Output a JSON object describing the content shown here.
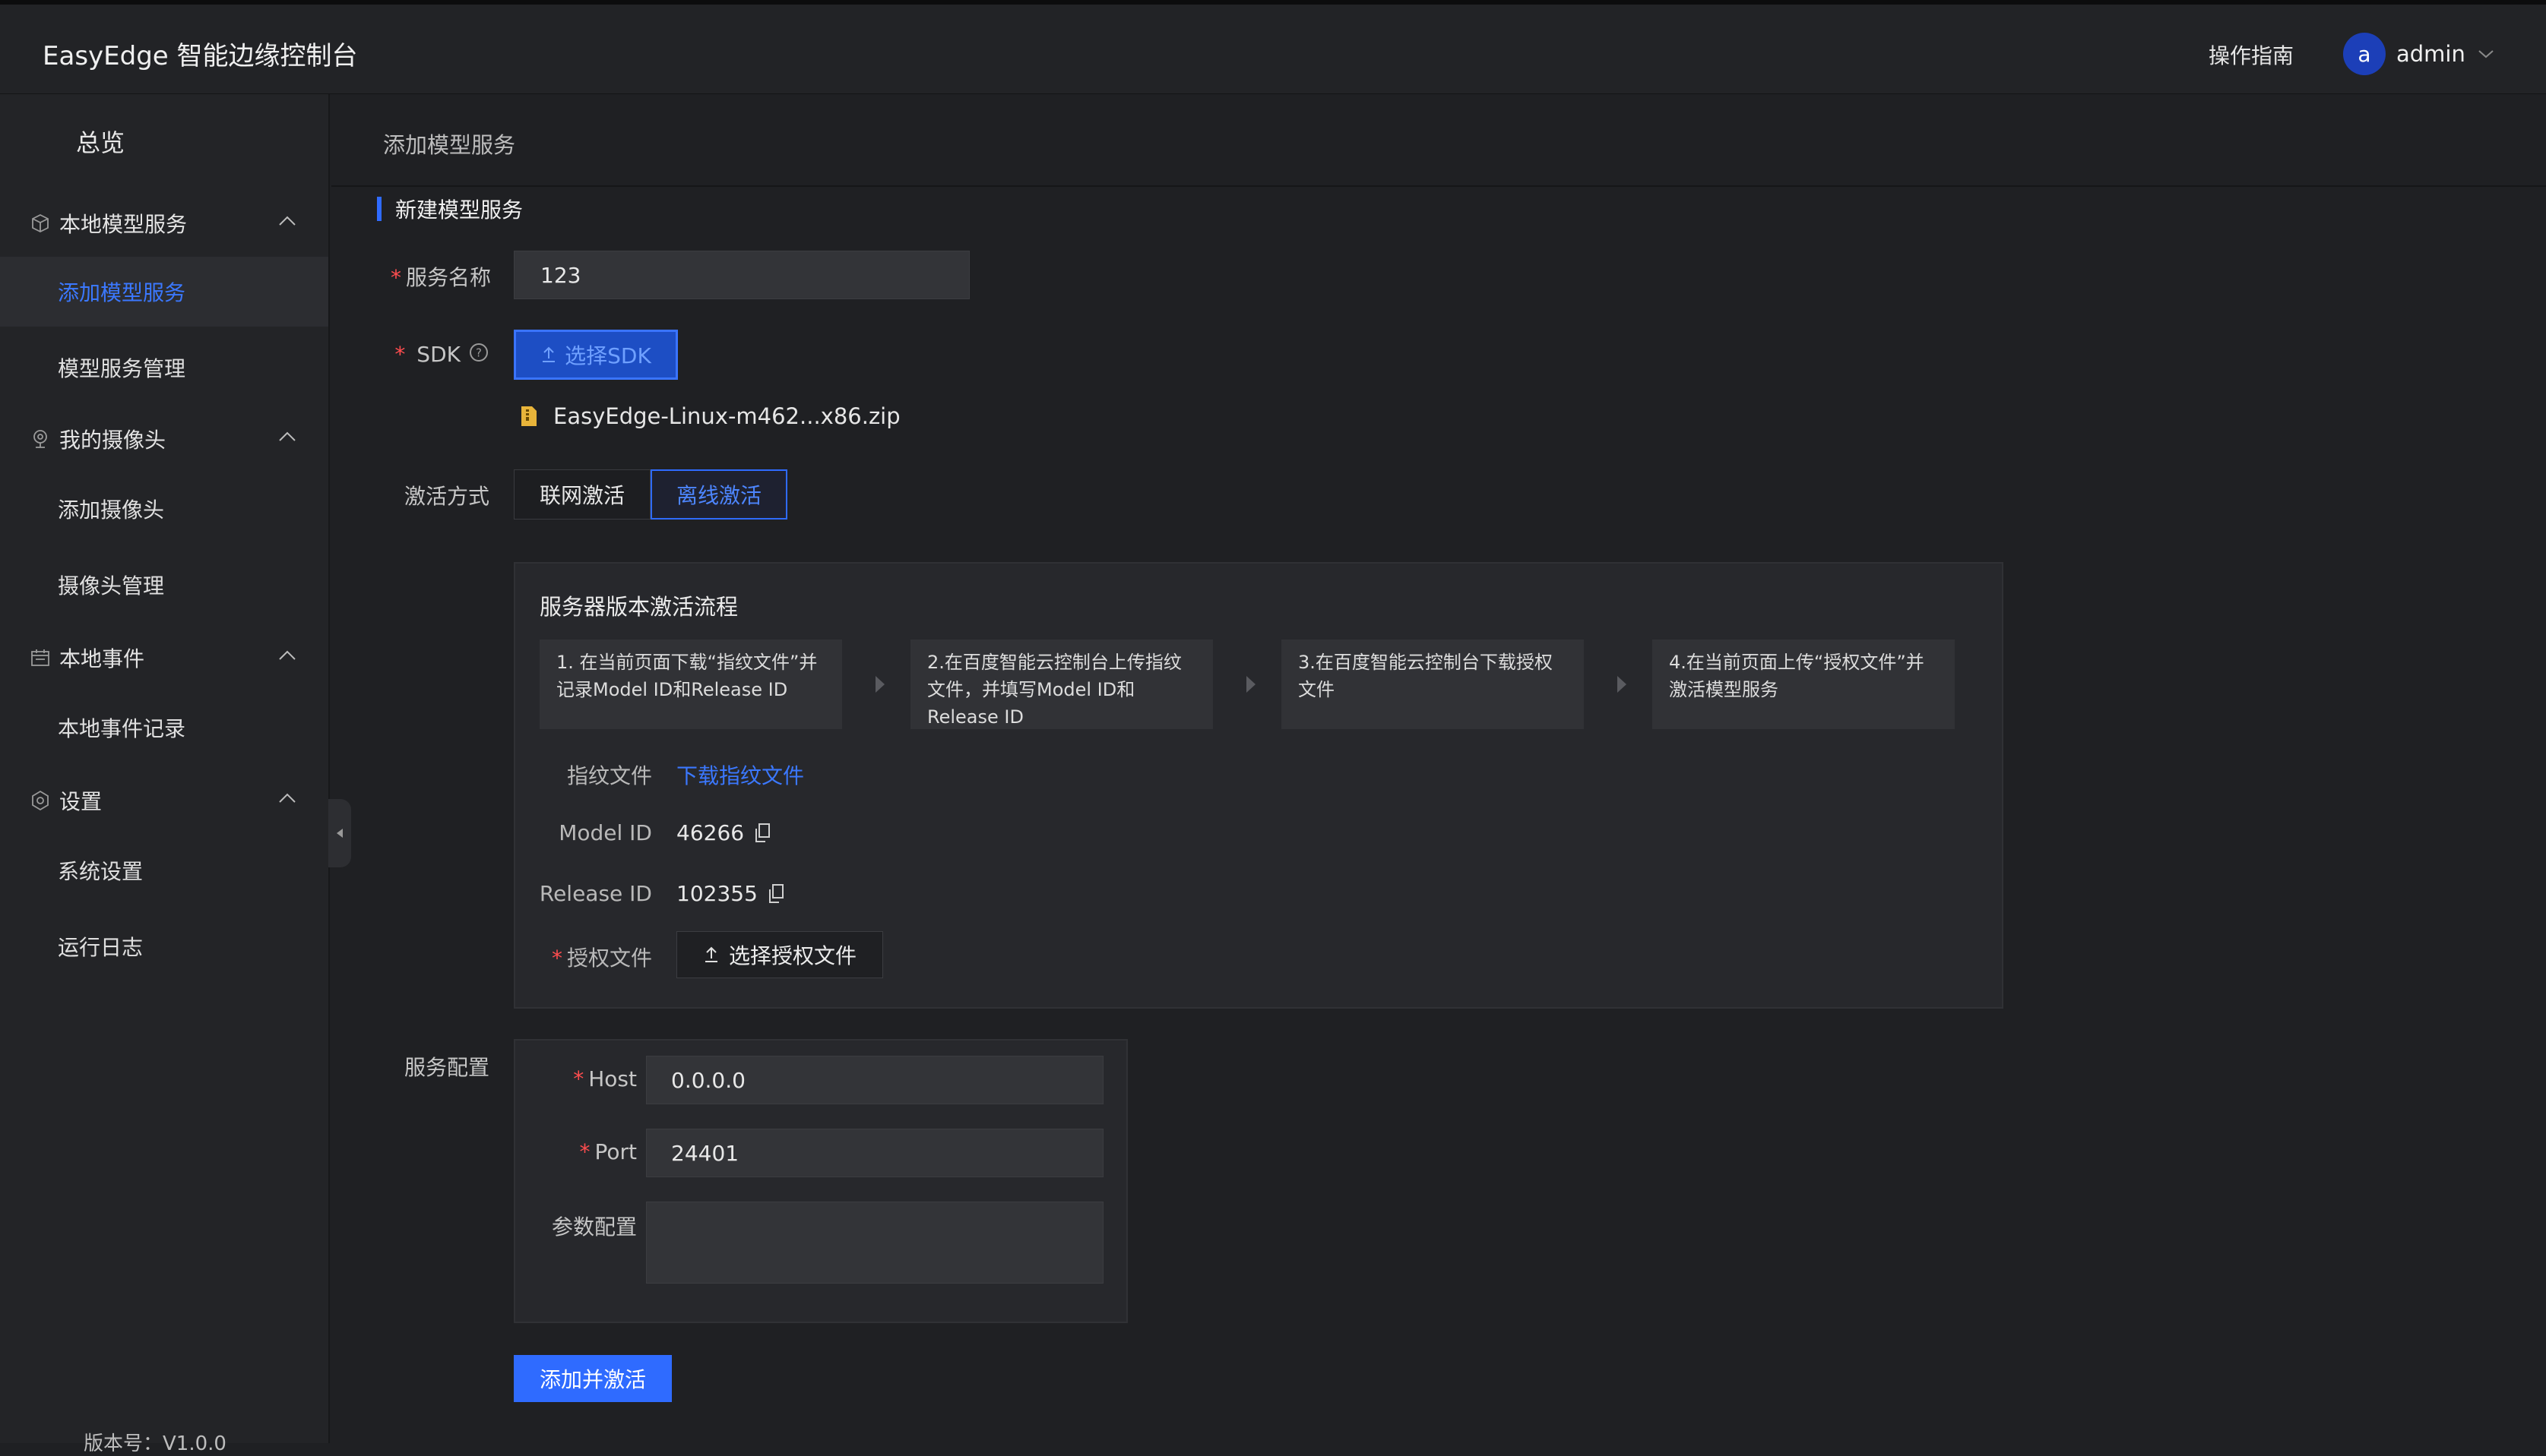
{
  "app": {
    "title": "EasyEdge 智能边缘控制台"
  },
  "header": {
    "guide": "操作指南",
    "user": {
      "avatar_letter": "a",
      "name": "admin"
    }
  },
  "sidebar": {
    "overview": "总览",
    "groups": [
      {
        "label": "本地模型服务",
        "icon": "cube-icon",
        "items": [
          {
            "label": "添加模型服务",
            "active": true
          },
          {
            "label": "模型服务管理",
            "active": false
          }
        ]
      },
      {
        "label": "我的摄像头",
        "icon": "camera-icon",
        "items": [
          {
            "label": "添加摄像头",
            "active": false
          },
          {
            "label": "摄像头管理",
            "active": false
          }
        ]
      },
      {
        "label": "本地事件",
        "icon": "calendar-icon",
        "items": [
          {
            "label": "本地事件记录",
            "active": false
          }
        ]
      },
      {
        "label": "设置",
        "icon": "settings-icon",
        "items": [
          {
            "label": "系统设置",
            "active": false
          },
          {
            "label": "运行日志",
            "active": false
          }
        ]
      }
    ],
    "version": "版本号：V1.0.0"
  },
  "breadcrumb": "添加模型服务",
  "form": {
    "section_title": "新建模型服务",
    "service_name": {
      "label": "服务名称",
      "value": "123"
    },
    "sdk": {
      "label": "SDK",
      "button": "选择SDK",
      "file": "EasyEdge-Linux-m462...x86.zip"
    },
    "activation": {
      "label": "激活方式",
      "online": "联网激活",
      "offline": "离线激活",
      "selected": "离线激活"
    },
    "offline_box": {
      "title": "服务器版本激活流程",
      "steps": [
        "1. 在当前页面下载“指纹文件”并记录Model ID和Release ID",
        "2.在百度智能云控制台上传指纹文件，并填写Model ID和Release ID",
        "3.在百度智能云控制台下载授权文件",
        "4.在当前页面上传“授权文件”并激活模型服务"
      ],
      "fingerprint_label": "指纹文件",
      "fingerprint_link": "下载指纹文件",
      "model_id_label": "Model ID",
      "model_id": "46266",
      "release_id_label": "Release ID",
      "release_id": "102355",
      "auth_label": "授权文件",
      "auth_button": "选择授权文件"
    },
    "service_config": {
      "label": "服务配置",
      "host_label": "Host",
      "host": "0.0.0.0",
      "port_label": "Port",
      "port": "24401",
      "params_label": "参数配置",
      "params": ""
    },
    "submit": "添加并激活"
  },
  "colors": {
    "accent": "#2f6bff",
    "link": "#3b78ff",
    "required": "#ff4d4f",
    "bg": "#1f2023"
  }
}
